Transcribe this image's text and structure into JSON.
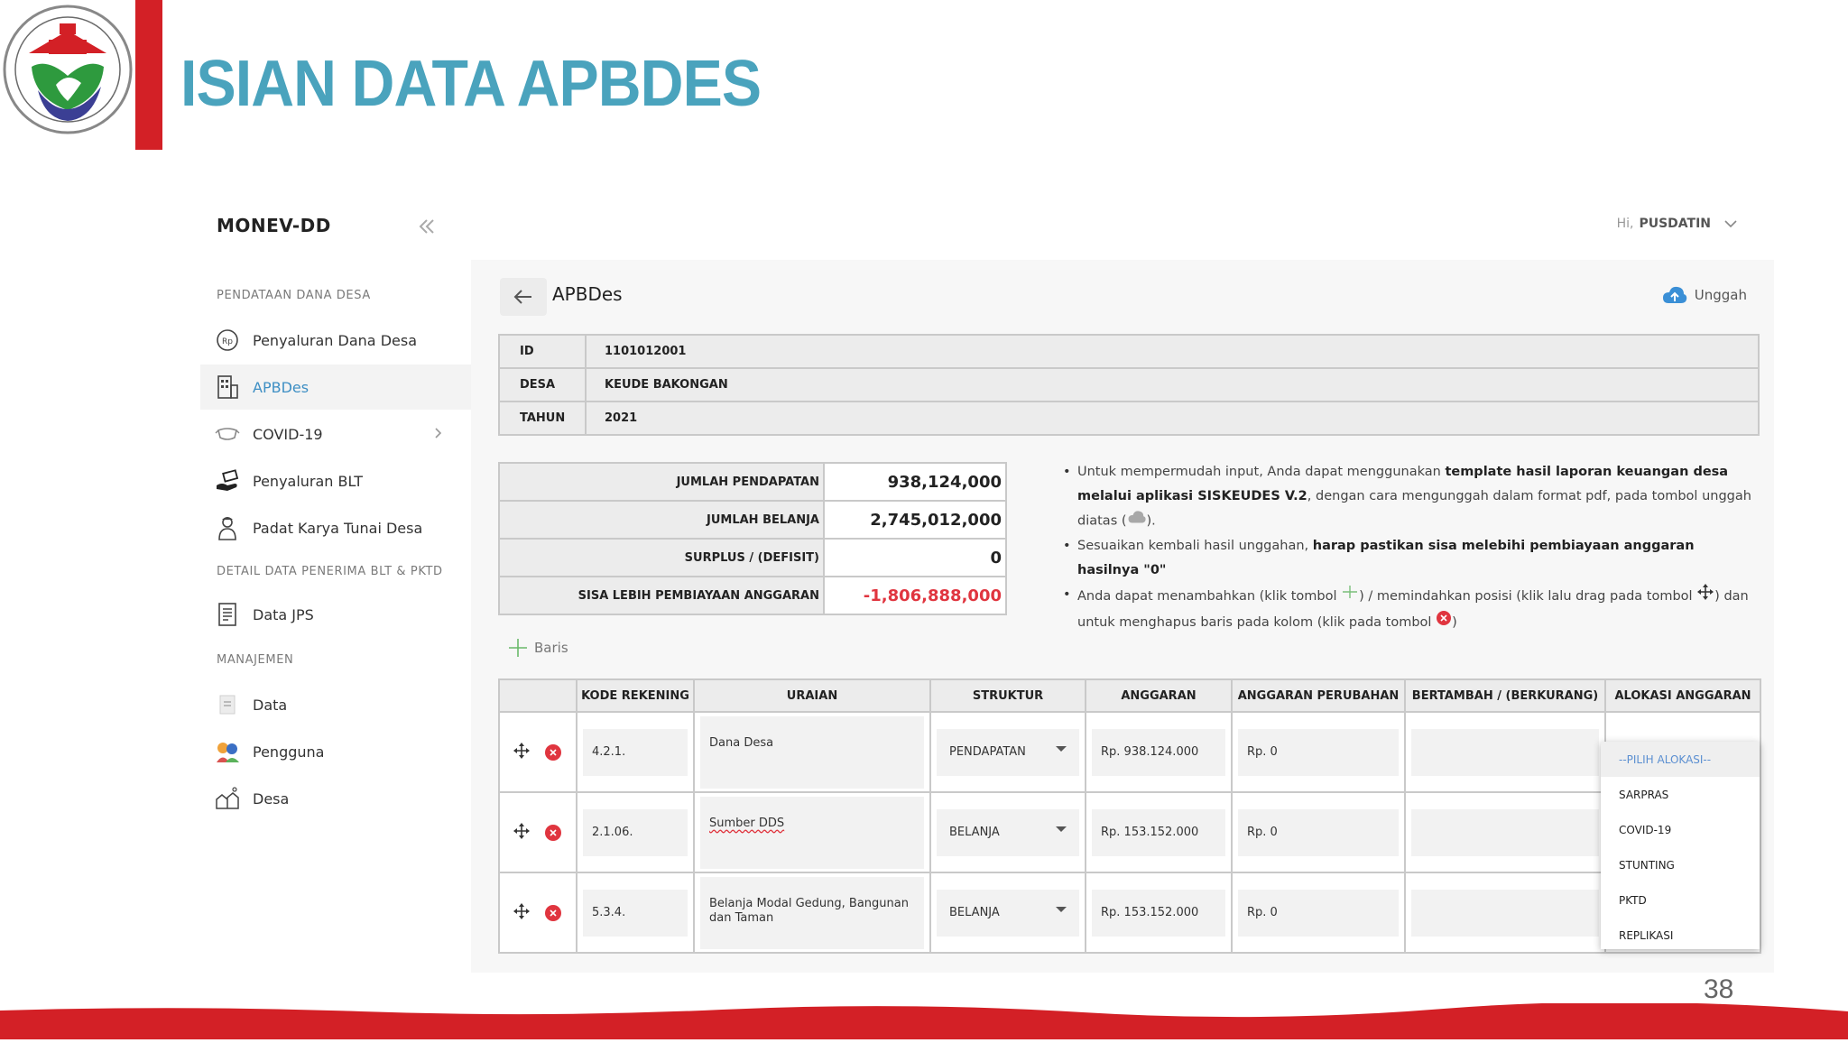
{
  "slide": {
    "title": "ISIAN DATA APBDES",
    "page_number": "38",
    "colors": {
      "title": "#4aa3bd",
      "accent_red": "#d32026",
      "negative": "#e0353f"
    }
  },
  "sidebar": {
    "brand": "MONEV-DD",
    "sections": [
      {
        "label": "PENDATAAN DANA DESA"
      },
      {
        "label": "DETAIL DATA PENERIMA BLT & PKTD"
      },
      {
        "label": "MANAJEMEN"
      }
    ],
    "items": [
      {
        "label": "Penyaluran Dana Desa",
        "icon": "rupiah-coin-icon"
      },
      {
        "label": "APBDes",
        "icon": "building-document-icon",
        "active": true
      },
      {
        "label": "COVID-19",
        "icon": "mask-icon"
      },
      {
        "label": "Penyaluran BLT",
        "icon": "hand-money-icon"
      },
      {
        "label": "Padat Karya Tunai Desa",
        "icon": "worker-icon"
      },
      {
        "label": "Data JPS",
        "icon": "document-list-icon"
      },
      {
        "label": "Data",
        "icon": "file-icon"
      },
      {
        "label": "Pengguna",
        "icon": "users-icon"
      },
      {
        "label": "Desa",
        "icon": "village-icon"
      }
    ]
  },
  "topbar": {
    "greeting": "Hi,",
    "user": "PUSDATIN"
  },
  "page": {
    "title": "APBDes",
    "upload_label": "Unggah"
  },
  "info": [
    {
      "key": "ID",
      "value": "1101012001"
    },
    {
      "key": "DESA",
      "value": "KEUDE BAKONGAN"
    },
    {
      "key": "TAHUN",
      "value": "2021"
    }
  ],
  "summary": [
    {
      "label": "JUMLAH PENDAPATAN",
      "value": "938,124,000"
    },
    {
      "label": "JUMLAH BELANJA",
      "value": "2,745,012,000"
    },
    {
      "label": "SURPLUS / (DEFISIT)",
      "value": "0"
    },
    {
      "label": "SISA LEBIH PEMBIAYAAN ANGGARAN",
      "value": "-1,806,888,000"
    }
  ],
  "notes": {
    "n1_a": "Untuk mempermudah input, Anda dapat menggunakan ",
    "n1_b": "template hasil laporan keuangan desa melalui aplikasi SISKEUDES V.2",
    "n1_c": ", dengan cara mengunggah dalam format pdf, pada tombol unggah diatas (",
    "n1_d": ").",
    "n2_a": "Sesuaikan kembali hasil unggahan, ",
    "n2_b": "harap pastikan sisa melebihi pembiayaan anggaran hasilnya \"0\"",
    "n3_a": "Anda dapat menambahkan (klik tombol ",
    "n3_b": ") / memindahkan posisi (klik lalu drag pada tombol ",
    "n3_c": ") dan untuk menghapus baris pada kolom (klik pada tombol ",
    "n3_d": ")"
  },
  "add_row_label": "Baris",
  "table": {
    "headers": [
      "",
      "KODE REKENING",
      "URAIAN",
      "STRUKTUR",
      "ANGGARAN",
      "ANGGARAN PERUBAHAN",
      "BERTAMBAH / (BERKURANG)",
      "ALOKASI ANGGARAN"
    ],
    "rows": [
      {
        "kode": "4.2.1.",
        "uraian": "Dana Desa",
        "struktur": "PENDAPATAN",
        "anggaran": "Rp. 938.124.000",
        "perubahan": "Rp. 0"
      },
      {
        "kode": "2.1.06.",
        "uraian": "Sumber DDS",
        "struktur": "BELANJA",
        "anggaran": "Rp. 153.152.000",
        "perubahan": "Rp. 0"
      },
      {
        "kode": "5.3.4.",
        "uraian": "Belanja Modal Gedung, Bangunan dan Taman",
        "struktur": "BELANJA",
        "anggaran": "Rp. 153.152.000",
        "perubahan": "Rp. 0"
      }
    ]
  },
  "alokasi_options": [
    "--PILIH ALOKASI--",
    "SARPRAS",
    "COVID-19",
    "STUNTING",
    "PKTD",
    "REPLIKASI"
  ]
}
